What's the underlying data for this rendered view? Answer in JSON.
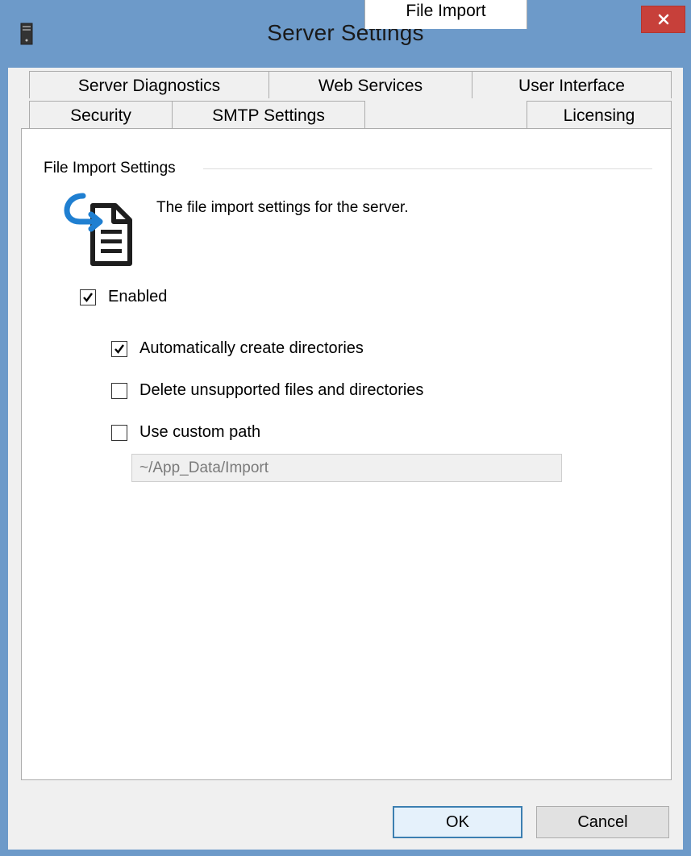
{
  "window": {
    "title": "Server Settings",
    "app_icon": "server-icon",
    "close_icon": "close-icon",
    "close_color": "#c7403a"
  },
  "tabs": {
    "row1": [
      {
        "label": "Server Diagnostics"
      },
      {
        "label": "Web Services"
      },
      {
        "label": "User Interface"
      }
    ],
    "row2": [
      {
        "label": "Security"
      },
      {
        "label": "SMTP Settings"
      },
      {
        "label": "File Import",
        "active": true
      },
      {
        "label": "Licensing"
      }
    ]
  },
  "panel": {
    "group_label": "File Import Settings",
    "icon": "file-import-icon",
    "description": "The file import settings for the server.",
    "enabled": {
      "label": "Enabled",
      "checked": true
    },
    "auto_create": {
      "label": "Automatically create directories",
      "checked": true
    },
    "delete_unsupported": {
      "label": "Delete unsupported files and directories",
      "checked": false
    },
    "custom_path": {
      "label": "Use custom path",
      "checked": false
    },
    "path_value": "~/App_Data/Import"
  },
  "buttons": {
    "ok": "OK",
    "cancel": "Cancel"
  },
  "colors": {
    "title_bar": "#6d9ac9",
    "accent_icon": "#1f7fd1",
    "default_button_border": "#3c7fb1"
  }
}
